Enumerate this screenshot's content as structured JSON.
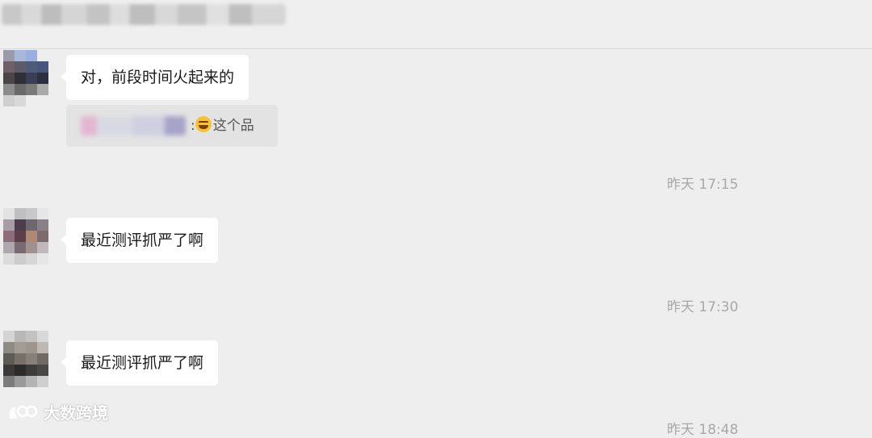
{
  "messages": [
    {
      "text": "对，前段时间火起来的",
      "quote": {
        "text": "这个品",
        "separator": ":",
        "emoji": "laughing-emoji"
      }
    },
    {
      "text": "最近测评抓严了啊"
    },
    {
      "text": "最近测评抓严了啊"
    }
  ],
  "timestamps": [
    "昨天 17:15",
    "昨天 17:30",
    "昨天 18:48"
  ],
  "watermark": {
    "text": "大数跨境"
  },
  "colors": {
    "background": "#eeeeee",
    "bubble": "#ffffff",
    "quote": "#e3e3e3",
    "timestamp": "#a8a8a8"
  }
}
